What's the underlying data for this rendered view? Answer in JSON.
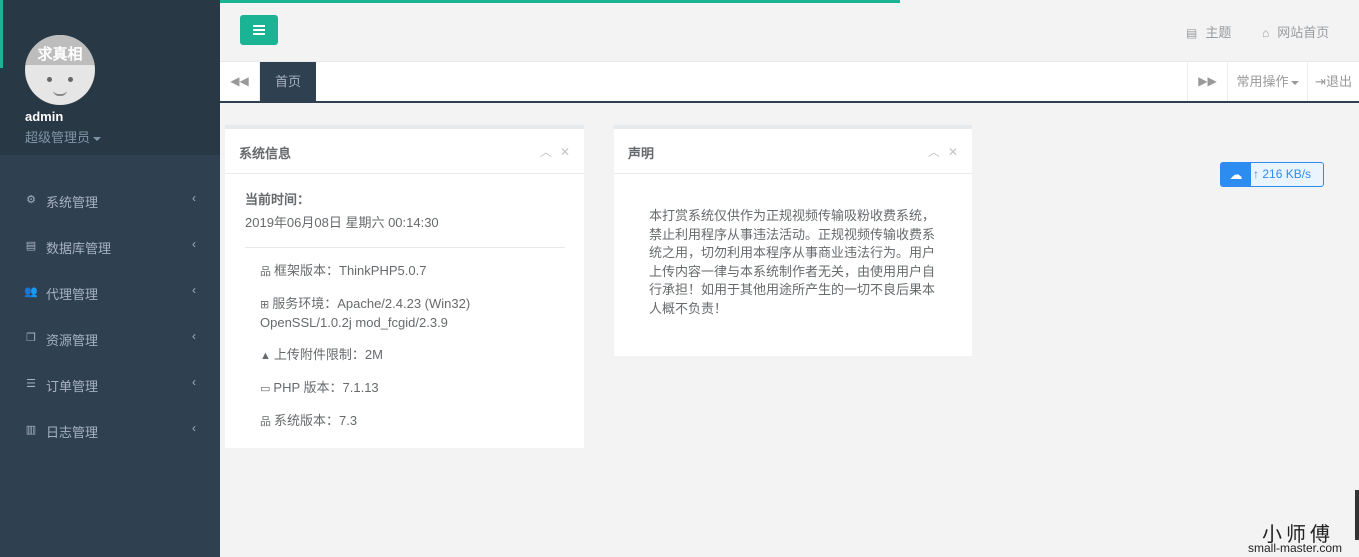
{
  "sidebar": {
    "avatar_text": "求真相",
    "username": "admin",
    "role": "超级管理员",
    "items": [
      {
        "label": "系统管理",
        "icon": "gear-icon"
      },
      {
        "label": "数据库管理",
        "icon": "database-icon"
      },
      {
        "label": "代理管理",
        "icon": "users-icon"
      },
      {
        "label": "资源管理",
        "icon": "copy-icon"
      },
      {
        "label": "订单管理",
        "icon": "list-icon"
      },
      {
        "label": "日志管理",
        "icon": "server-icon"
      }
    ]
  },
  "header": {
    "theme_label": "主题",
    "home_label": "网站首页"
  },
  "tabs": {
    "active_label": "首页",
    "ops_label": "常用操作",
    "logout_label": "退出"
  },
  "system_panel": {
    "title": "系统信息",
    "time_label": "当前时间：",
    "time_value": "2019年06月08日 星期六 00:14:30",
    "items": [
      {
        "icon": "sitemap-icon",
        "text": "框架版本：ThinkPHP5.0.7"
      },
      {
        "icon": "windows-icon",
        "text": "服务环境：Apache/2.4.23 (Win32) OpenSSL/1.0.2j mod_fcgid/2.3.9"
      },
      {
        "icon": "warning-icon",
        "text": "上传附件限制：2M"
      },
      {
        "icon": "credit-card-icon",
        "text": "PHP 版本：7.1.13"
      },
      {
        "icon": "sitemap-icon",
        "text": "系统版本：7.3"
      }
    ]
  },
  "notice_panel": {
    "title": "声明",
    "body": "本打赏系统仅供作为正规视频传输吸粉收费系统，禁止利用程序从事违法活动。正规视频传输收费系统之用，切勿利用本程序从事商业违法行为。用户上传内容一律与本系统制作者无关，由使用用户自行承担！如用于其他用途所产生的一切不良后果本人概不负责！"
  },
  "speed_widget": {
    "value": "216 KB/s"
  },
  "watermark": {
    "cn": "小师傅",
    "en": "small-master.com"
  },
  "colors": {
    "accent": "#1ab394",
    "sidebar_bg": "#2f4050",
    "speed_blue": "#2d8cf0"
  }
}
